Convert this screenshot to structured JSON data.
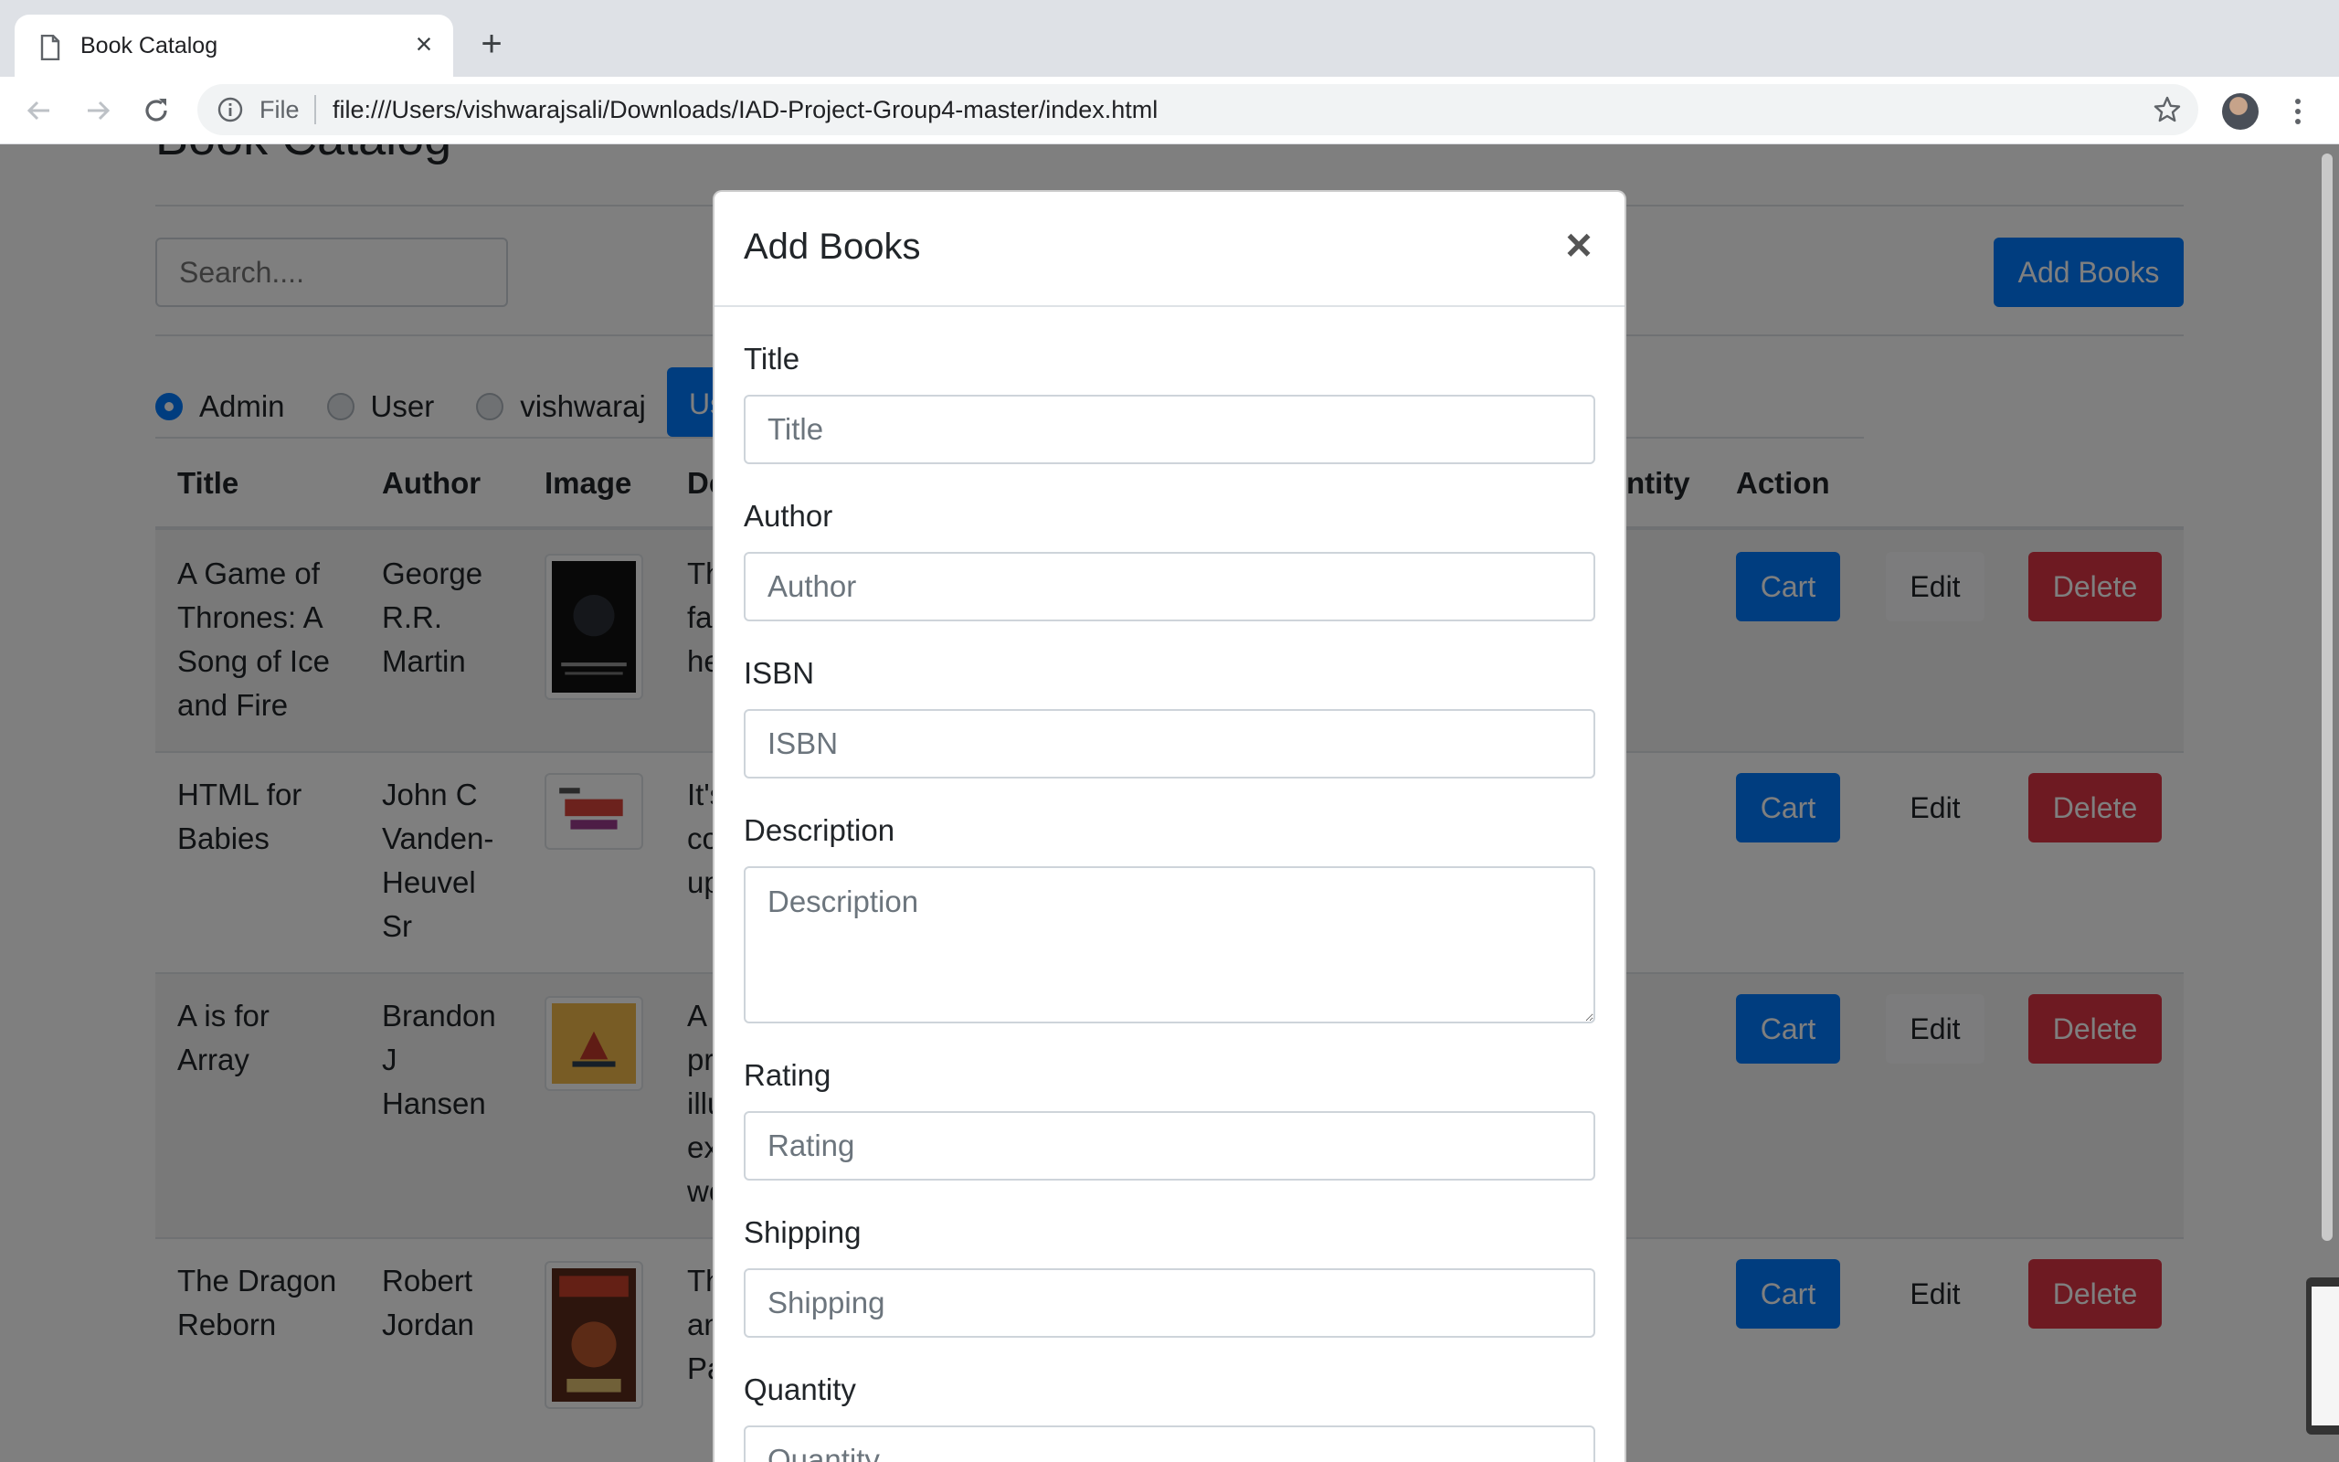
{
  "browser": {
    "tab_title": "Book Catalog",
    "close_glyph": "×",
    "new_tab_glyph": "+",
    "file_label": "File",
    "url": "file:///Users/vishwarajsali/Downloads/IAD-Project-Group4-master/index.html",
    "icons": [
      "page-icon",
      "back-icon",
      "forward-icon",
      "reload-icon",
      "info-icon",
      "star-icon",
      "profile-avatar",
      "menu-icon"
    ]
  },
  "page": {
    "title": "Book Catalog",
    "search_placeholder": "Search....",
    "add_books_label": "Add Books",
    "roles": [
      {
        "label": "Admin",
        "checked": true
      },
      {
        "label": "User",
        "checked": false
      },
      {
        "label": "vishwaraj",
        "checked": false
      }
    ],
    "update_button_partial": "Us",
    "columns": {
      "title": "Title",
      "author": "Author",
      "image": "Image",
      "description_partial": "De",
      "quantity_partial": "ntity",
      "action": "Action"
    },
    "rows": [
      {
        "title_lines": [
          "A Game of",
          "Thrones: A",
          "Song of Ice",
          "and Fire"
        ],
        "author_lines": [
          "George",
          "R.R.",
          "Martin"
        ],
        "desc_lines": [
          "Th",
          "fa",
          "he"
        ]
      },
      {
        "title_lines": [
          "HTML for",
          "Babies"
        ],
        "author_lines": [
          "John C",
          "Vanden-",
          "Heuvel",
          "Sr"
        ],
        "desc_lines": [
          "It's",
          "co",
          "up"
        ]
      },
      {
        "title_lines": [
          "A is for",
          "Array"
        ],
        "author_lines": [
          "Brandon",
          "J",
          "Hansen"
        ],
        "desc_lines": [
          "A",
          "pr",
          "illu",
          "ex",
          "wo"
        ]
      },
      {
        "title_lines": [
          "The Dragon",
          "Reborn"
        ],
        "author_lines": [
          "Robert",
          "Jordan"
        ],
        "desc_lines": [
          "Th",
          "an",
          "Pa"
        ]
      }
    ],
    "cart_label": "Cart",
    "edit_label": "Edit",
    "delete_label": "Delete"
  },
  "modal": {
    "title": "Add Books",
    "close_glyph": "×",
    "fields": {
      "title": {
        "label": "Title",
        "placeholder": "Title"
      },
      "author": {
        "label": "Author",
        "placeholder": "Author"
      },
      "isbn": {
        "label": "ISBN",
        "placeholder": "ISBN"
      },
      "description": {
        "label": "Description",
        "placeholder": "Description"
      },
      "rating": {
        "label": "Rating",
        "placeholder": "Rating"
      },
      "shipping": {
        "label": "Shipping",
        "placeholder": "Shipping"
      },
      "quantity": {
        "label": "Quantity",
        "placeholder": "Quantity"
      }
    }
  },
  "colors": {
    "primary": "#007bff",
    "danger": "#dc3545",
    "backdrop": "rgba(0,0,0,0.5)"
  }
}
